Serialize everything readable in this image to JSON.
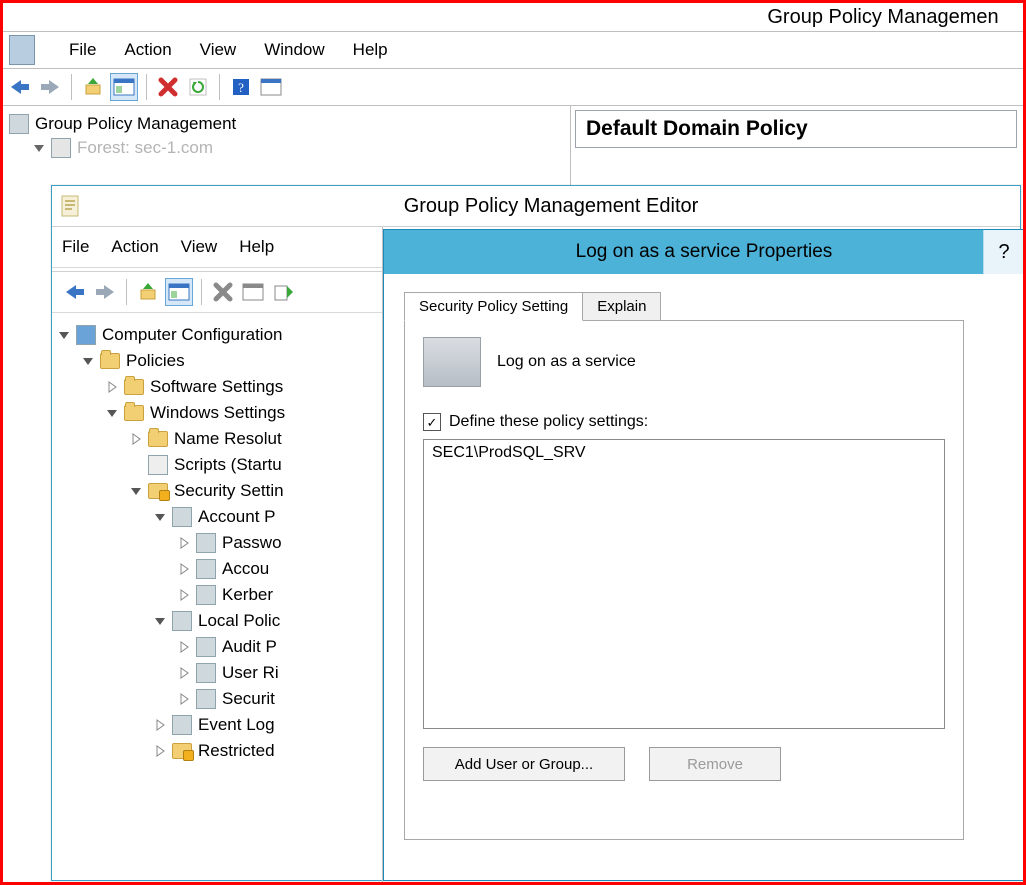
{
  "gpm": {
    "title": "Group Policy Managemen",
    "menu": {
      "file": "File",
      "action": "Action",
      "view": "View",
      "window": "Window",
      "help": "Help"
    },
    "tree": {
      "root": "Group Policy Management",
      "forest": "Forest: sec-1.com"
    },
    "right_header": "Default Domain Policy"
  },
  "gpme": {
    "title": "Group Policy Management Editor",
    "menu": {
      "file": "File",
      "action": "Action",
      "view": "View",
      "help": "Help"
    },
    "tree": {
      "n0": "Computer Configuration",
      "n1": "Policies",
      "n2": "Software Settings",
      "n3": "Windows Settings",
      "n4": "Name Resolut",
      "n5": "Scripts (Startu",
      "n6": "Security Settin",
      "n7": "Account P",
      "n8": "Passwo",
      "n9": "Accou",
      "n10": "Kerber",
      "n11": "Local Polic",
      "n12": "Audit P",
      "n13": "User Ri",
      "n14": "Securit",
      "n15": "Event Log",
      "n16": "Restricted"
    }
  },
  "dialog": {
    "title": "Log on as a service Properties",
    "help": "?",
    "tabs": {
      "setting": "Security Policy Setting",
      "explain": "Explain"
    },
    "policy_name": "Log on as a service",
    "checkbox_label": "Define these policy settings:",
    "checkbox_checked": true,
    "list": [
      "SEC1\\ProdSQL_SRV"
    ],
    "btn_add": "Add User or Group...",
    "btn_remove": "Remove"
  }
}
